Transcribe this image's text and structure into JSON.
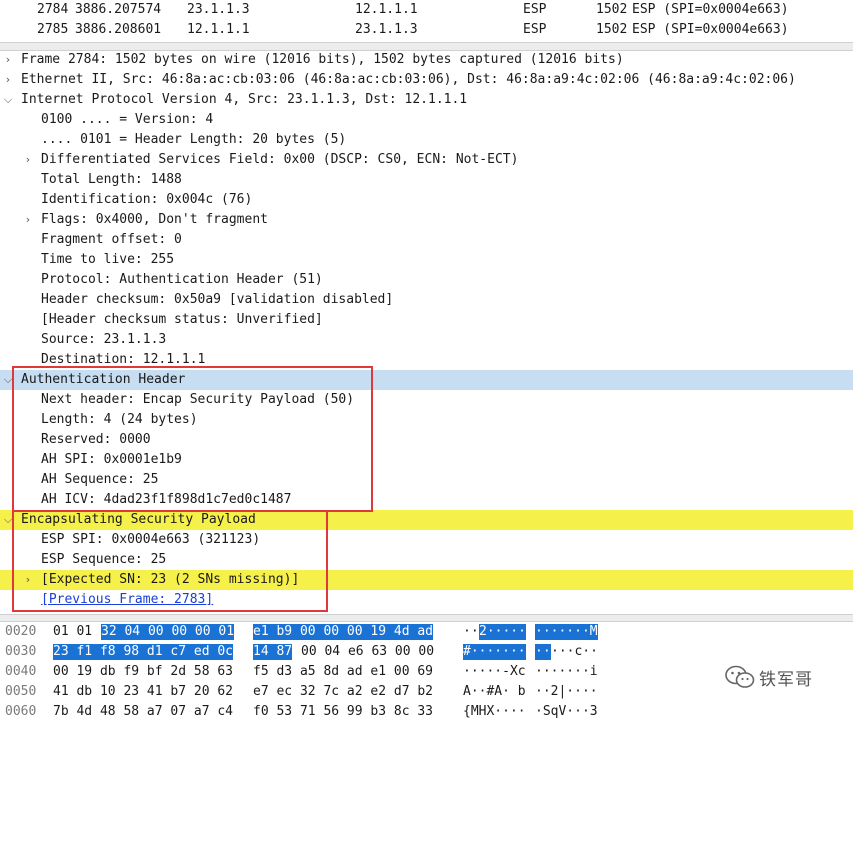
{
  "packet_list": {
    "rows": [
      {
        "no": "2784",
        "time": "3886.207574",
        "src": "23.1.1.3",
        "dst": "12.1.1.1",
        "proto": "ESP",
        "len": "1502",
        "info": "ESP (SPI=0x0004e663)"
      },
      {
        "no": "2785",
        "time": "3886.208601",
        "src": "12.1.1.1",
        "dst": "23.1.1.3",
        "proto": "ESP",
        "len": "1502",
        "info": "ESP (SPI=0x0004e663)"
      }
    ]
  },
  "details": {
    "frame": "Frame 2784: 1502 bytes on wire (12016 bits), 1502 bytes captured (12016 bits)",
    "ethernet": "Ethernet II, Src: 46:8a:ac:cb:03:06 (46:8a:ac:cb:03:06), Dst: 46:8a:a9:4c:02:06 (46:8a:a9:4c:02:06)",
    "ip": {
      "header": "Internet Protocol Version 4, Src: 23.1.1.3, Dst: 12.1.1.1",
      "version": "0100 .... = Version: 4",
      "header_length": ".... 0101 = Header Length: 20 bytes (5)",
      "dsfield": "Differentiated Services Field: 0x00 (DSCP: CS0, ECN: Not-ECT)",
      "total_length": "Total Length: 1488",
      "identification": "Identification: 0x004c (76)",
      "flags": "Flags: 0x4000, Don't fragment",
      "fragment_offset": "Fragment offset: 0",
      "ttl": "Time to live: 255",
      "protocol": "Protocol: Authentication Header (51)",
      "checksum": "Header checksum: 0x50a9 [validation disabled]",
      "checksum_status": "[Header checksum status: Unverified]",
      "source": "Source: 23.1.1.3",
      "destination": "Destination: 12.1.1.1"
    },
    "ah": {
      "header": "Authentication Header",
      "next_header": "Next header: Encap Security Payload (50)",
      "length": "Length: 4 (24 bytes)",
      "reserved": "Reserved: 0000",
      "spi": "AH SPI: 0x0001e1b9",
      "sequence": "AH Sequence: 25",
      "icv": "AH ICV: 4dad23f1f898d1c7ed0c1487"
    },
    "esp": {
      "header": "Encapsulating Security Payload",
      "spi": "ESP SPI: 0x0004e663 (321123)",
      "sequence": "ESP Sequence: 25",
      "expected_sn": "[Expected SN: 23 (2 SNs missing)]",
      "previous_frame": "[Previous Frame: 2783]"
    }
  },
  "bytes": {
    "rows": [
      {
        "offset": "0020",
        "hex_plain": "01 01",
        "hex_sel_a": "32 04 00 00 00 01",
        "hex_sel_b": "e1 b9 00 00 00 19 4d ad",
        "ascii_plain": "··",
        "ascii_sel_a": "2·····",
        "ascii_sel_b": "·······M"
      },
      {
        "offset": "0030",
        "hex_sel_a": "23 f1 f8 98 d1 c7 ed 0c",
        "hex_sel_b": "14 87",
        "hex_plain": "00 04 e6 63 00 00",
        "ascii_sel_a": "#·······",
        "ascii_sel_b": "··",
        "ascii_plain": "···c··"
      },
      {
        "offset": "0040",
        "hex_a": "00 19 db f9 bf 2d 58 63",
        "hex_b": "f5 d3 a5 8d ad e1 00 69",
        "ascii_a": "·····-Xc",
        "ascii_b": "·······i"
      },
      {
        "offset": "0050",
        "hex_a": "41 db 10 23 41 b7 20 62",
        "hex_b": "e7 ec 32 7c a2 e2 d7 b2",
        "ascii_a": "A··#A· b",
        "ascii_b": "··2|····"
      },
      {
        "offset": "0060",
        "hex_a": "7b 4d 48 58 a7 07 a7 c4",
        "hex_b": "f0 53 71 56 99 b3 8c 33",
        "ascii_a": "{MHX····",
        "ascii_b": "·SqV···3"
      }
    ]
  },
  "watermark": {
    "text": "铁军哥",
    "icon": "wechat-icon"
  },
  "colors": {
    "selection_blue": "#c6ddf2",
    "warning_yellow": "#f6f14a",
    "annotation_red": "#e0393b",
    "byte_select": "#1a73d4"
  }
}
